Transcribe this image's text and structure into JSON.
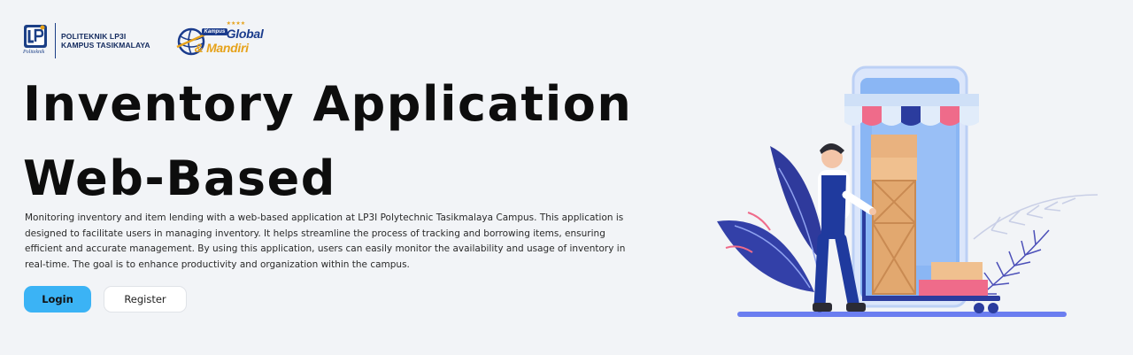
{
  "header": {
    "institution_line1": "POLITEKNIK LP3I",
    "institution_line2": "KAMPUS TASIKMALAYA",
    "lp3i_mark_text": "LP3I",
    "lp3i_signature": "Politeknik",
    "partner_logo": {
      "kampus": "Kampus",
      "global": "Global",
      "mandiri": "& Mandiri",
      "stars": "★★★★"
    }
  },
  "hero": {
    "title_line1": "Inventory Application",
    "title_line2": "Web-Based",
    "description": "Monitoring inventory and item lending with a web-based application at LP3I Polytechnic Tasikmalaya Campus. This application is designed to facilitate users in managing inventory. It helps streamline the process of tracking and borrowing items, ensuring efficient and accurate management. By using this application, users can easily monitor the availability and usage of inventory in real-time. The goal is to enhance productivity and organization within the campus."
  },
  "actions": {
    "login_label": "Login",
    "register_label": "Register"
  },
  "colors": {
    "background": "#f2f4f7",
    "login_button": "#3bb3f5",
    "brand_navy": "#1a3b8c",
    "brand_gold": "#e6a21a"
  },
  "icons": {
    "lp3i_logo": "lp3i-logo-icon",
    "partner_logo": "kampus-global-mandiri-logo",
    "illustration": "delivery-worker-with-boxes-illustration"
  }
}
